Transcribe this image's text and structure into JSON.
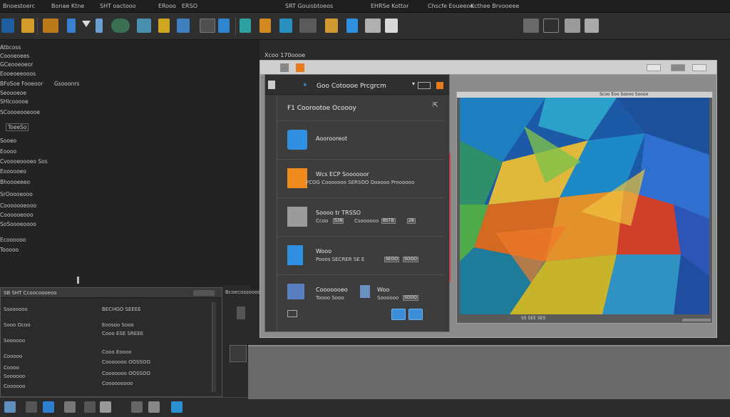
{
  "menubar": {
    "items": [
      "Bnoestoerc",
      "Bonae Ktne",
      "SHT oactooo",
      "ERooo",
      "ERSO",
      "SRT Gouisbtoeos",
      "EHRSe Kottor",
      "Chscfe Eoueeoe",
      "Kcthee Brvooeee"
    ]
  },
  "left_panel": {
    "items": [
      "Atbcoss",
      "Coooeoees",
      "GCeooeoeor",
      "Eooeoeeooos",
      "BFoSoe Fooeoor",
      "Seoooeoe",
      "SHlcooooe",
      "SCoooeooeooe",
      "ToeeSo",
      "Sooeo",
      "Eoooo",
      "Cvoooeoooeo Sos",
      "Eoooooeo",
      "Bhoooeeeo",
      "SrOoooeooo",
      "Cooooooeooo",
      "Coooooeooo",
      "SoSoooeoooo",
      "Ecoooooo",
      "Tooooo"
    ],
    "note_label": "Gsooonrs"
  },
  "bottom_window": {
    "title_left": "SB SHT Ccoocoooeoo",
    "title_right": "Bcoecossooos",
    "rows": [
      [
        "Ssoooooo",
        "BECHGO SEEEE"
      ],
      [
        "Sooo Ocoo",
        "Eoosoo Sooo"
      ],
      [
        "Soooooo",
        "Cooo ESE SREEE"
      ],
      [
        "Cooooo",
        "Cooo Eoooo"
      ],
      [
        "Coooo",
        "Cooooooo OOSSOO"
      ],
      [
        "Soooooo",
        "Cooooooo OOSSOO"
      ],
      [
        "Coooooo",
        "Cooooooooo"
      ]
    ]
  },
  "main_window": {
    "title": "Xcoo 170oooe"
  },
  "dialog": {
    "title": "Goo Cotoooe Prcgrcm",
    "subtitle": "F1 Coorootoe Ocoooy",
    "options": [
      {
        "icon": "cloud-folder-icon",
        "line1": "Aoorooreot",
        "line2": ""
      },
      {
        "icon": "orange-box-icon",
        "line1": "Wcs ECP Soooooor",
        "line2": "FCOG Cooooooo SERSOO Oooooo Proooooo"
      },
      {
        "icon": "document-stack-icon",
        "line1": "Soooo tr TRSSO",
        "line2": "Ccoo",
        "field1": "S38",
        "field1b": "Csoooooo",
        "field2": "BSTB",
        "field3": "28"
      },
      {
        "icon": "blue-file-icon",
        "line1": "Wooo",
        "line2": "Pooos SECRER SE E",
        "field1": "SEOO",
        "field2": "SOOO"
      },
      {
        "icon": "blue-window-icon",
        "line1": "Cooooooeo",
        "line2": "Toooo Sooo",
        "extra1": "Woo",
        "extra2": "Soooooo",
        "field1": "SOOO"
      }
    ]
  },
  "image_panel": {
    "header": "Scoo Eoo Soooo Soooo",
    "footer": "SS SEE SES"
  },
  "colors": {
    "accent_blue": "#3a8fd8",
    "accent_orange": "#e87a20",
    "panel_bg": "#232323"
  }
}
